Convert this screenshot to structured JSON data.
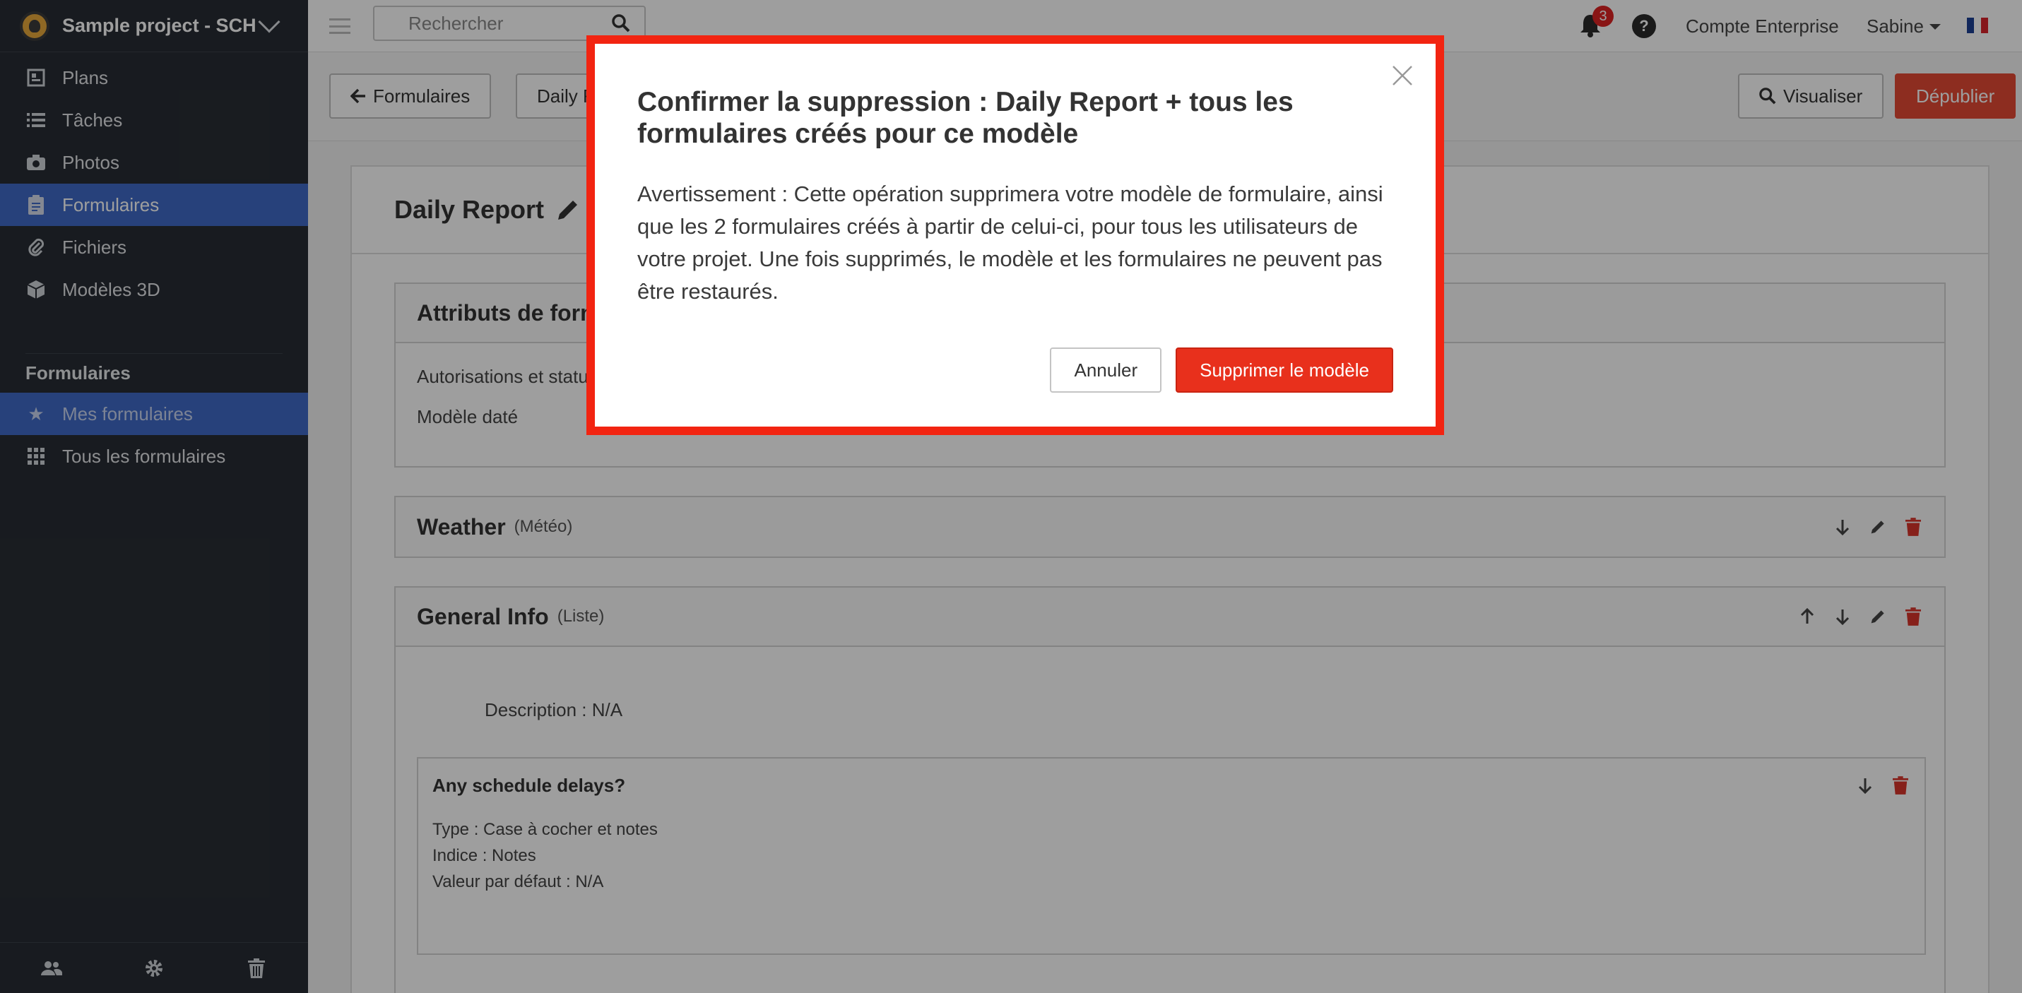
{
  "sidebar": {
    "project_name": "Sample project - SCH",
    "nav": [
      {
        "label": "Plans",
        "icon": "plans-icon"
      },
      {
        "label": "Tâches",
        "icon": "list-icon"
      },
      {
        "label": "Photos",
        "icon": "camera-icon"
      },
      {
        "label": "Formulaires",
        "icon": "clipboard-icon"
      },
      {
        "label": "Fichiers",
        "icon": "paperclip-icon"
      },
      {
        "label": "Modèles 3D",
        "icon": "cube-icon"
      }
    ],
    "section_title": "Formulaires",
    "sub_nav": [
      {
        "label": "Mes formulaires",
        "icon": "star-icon"
      },
      {
        "label": "Tous les formulaires",
        "icon": "grid-icon"
      }
    ]
  },
  "topbar": {
    "search_placeholder": "Rechercher",
    "notification_count": "3",
    "help": "?",
    "account": "Compte Enterprise",
    "user": "Sabine"
  },
  "toolbar": {
    "back_label": "Formulaires",
    "current_label": "Daily Report",
    "preview_label": "Visualiser",
    "unpublish_label": "Dépublier"
  },
  "content": {
    "title": "Daily Report",
    "attributes": {
      "title": "Attributs de formulaire",
      "rows": [
        "Autorisations et statuts",
        "Modèle daté"
      ]
    },
    "weather": {
      "title": "Weather",
      "sub": "(Météo)"
    },
    "general": {
      "title": "General Info",
      "sub": "(Liste)",
      "description": "Description : N/A",
      "question": {
        "title": "Any schedule delays?",
        "type": "Type : Case à cocher et notes",
        "hint": "Indice : Notes",
        "default": "Valeur par défaut : N/A"
      }
    }
  },
  "modal": {
    "title": "Confirmer la suppression : Daily Report + tous les formulaires créés pour ce modèle",
    "body": "Avertissement : Cette opération supprimera votre modèle de formulaire, ainsi que les 2 formulaires créés à partir de celui-ci, pour tous les utilisateurs de votre projet. Une fois supprimés, le modèle et les formulaires ne peuvent pas être restaurés.",
    "cancel_label": "Annuler",
    "confirm_label": "Supprimer le modèle"
  },
  "colors": {
    "sidebar_bg": "#282d34",
    "active": "#3f6ac7",
    "danger": "#e8301c",
    "highlight_border": "#f22411"
  }
}
